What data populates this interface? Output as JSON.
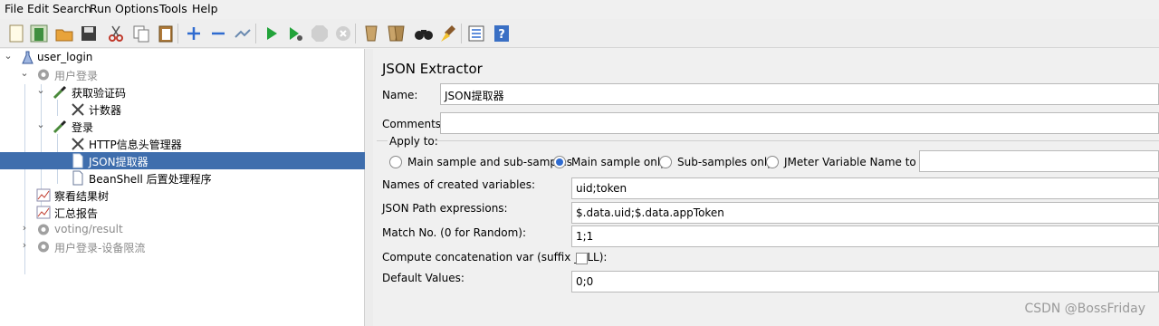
{
  "menu": [
    "File",
    "Edit",
    "Search",
    "Run",
    "Options",
    "Tools",
    "Help"
  ],
  "toolbar_icons": [
    "new-icon",
    "templates-icon",
    "open-icon",
    "save-icon",
    "cut-icon",
    "copy-icon",
    "paste-icon",
    "expand-icon",
    "collapse-icon",
    "toggle-icon",
    "start-icon",
    "start-no-pauses-icon",
    "stop-icon",
    "shutdown-icon",
    "clear-icon",
    "clear-all-icon",
    "search-icon",
    "reset-search-icon",
    "function-helper-icon",
    "help-icon"
  ],
  "tree": [
    {
      "label": "user_login",
      "grey": false
    },
    {
      "label": "用户登录",
      "grey": true
    },
    {
      "label": "获取验证码",
      "grey": false
    },
    {
      "label": "计数器",
      "grey": false
    },
    {
      "label": "登录",
      "grey": false
    },
    {
      "label": "HTTP信息头管理器",
      "grey": false
    },
    {
      "label": "JSON提取器",
      "grey": false
    },
    {
      "label": "BeanShell 后置处理程序",
      "grey": false
    },
    {
      "label": "察看结果树",
      "grey": false
    },
    {
      "label": "汇总报告",
      "grey": false
    },
    {
      "label": "voting/result",
      "grey": true
    },
    {
      "label": "用户登录-设备限流",
      "grey": true
    }
  ],
  "panel": {
    "title": "JSON Extractor",
    "name_label": "Name:",
    "name_value": "JSON提取器",
    "comments_label": "Comments:",
    "comments_value": "",
    "apply_to": "Apply to:",
    "radios": [
      {
        "label": "Main sample and sub-samples",
        "selected": false
      },
      {
        "label": "Main sample only",
        "selected": true
      },
      {
        "label": "Sub-samples only",
        "selected": false
      },
      {
        "label": "JMeter Variable Name to use",
        "selected": false
      }
    ],
    "jmeter_var_value": "",
    "vars_label": "Names of created variables:",
    "vars_value": "uid;token",
    "jsonpath_label": "JSON Path expressions:",
    "jsonpath_value": "$.data.uid;$.data.appToken",
    "match_label": "Match No. (0 for Random):",
    "match_value": "1;1",
    "concat_label": "Compute concatenation var (suffix _ALL):",
    "concat_checked": false,
    "default_label": "Default Values:",
    "default_value": "0;0"
  },
  "watermark": "CSDN @BossFriday"
}
